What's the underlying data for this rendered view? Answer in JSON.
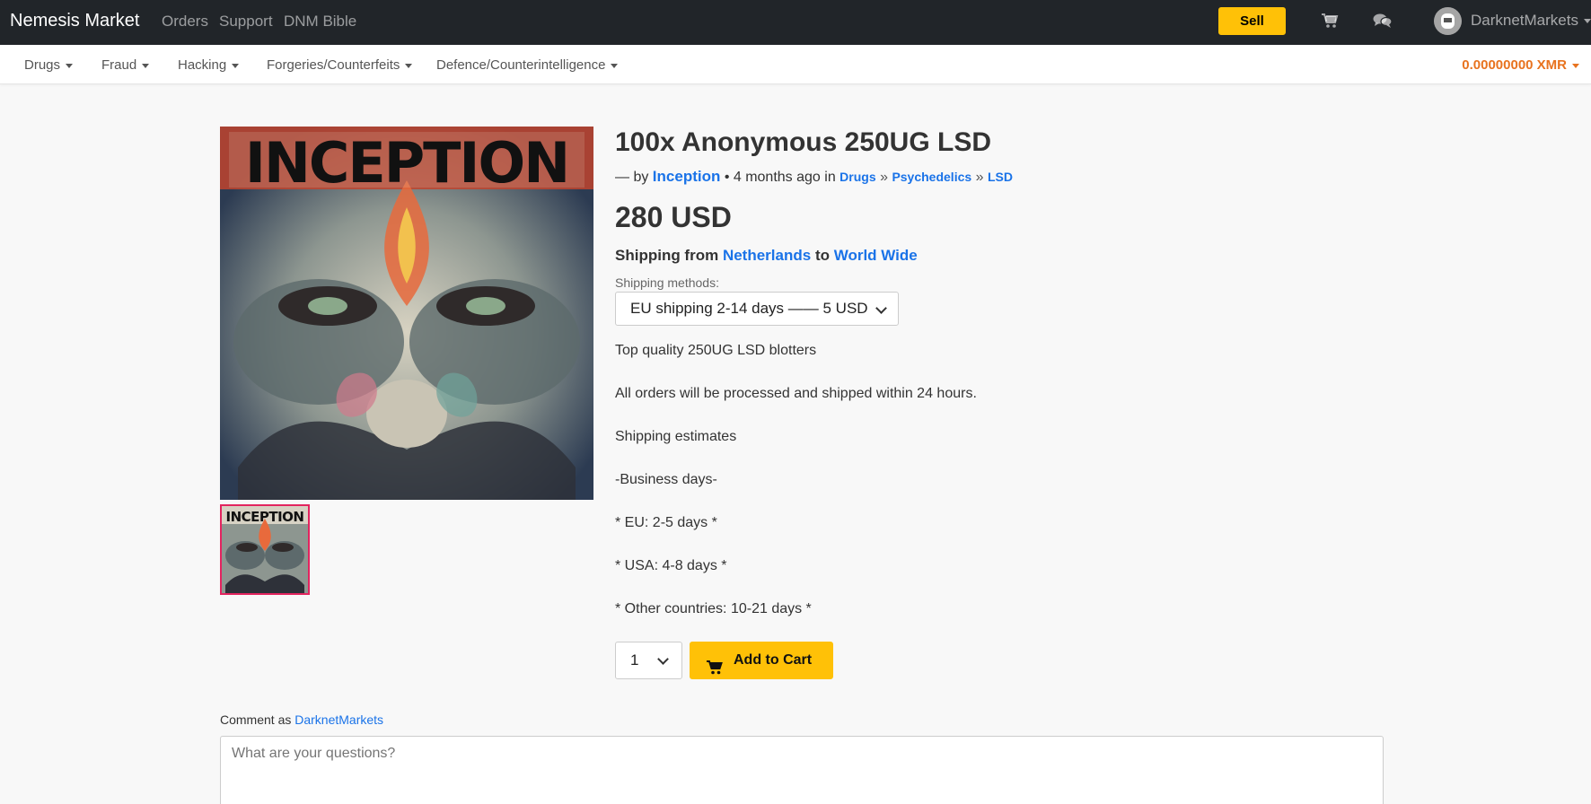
{
  "nav": {
    "brand": "Nemesis Market",
    "links": [
      "Orders",
      "Support",
      "DNM Bible"
    ],
    "sell_label": "Sell",
    "username": "DarknetMarkets"
  },
  "categories": [
    "Drugs",
    "Fraud",
    "Hacking",
    "Forgeries/Counterfeits",
    "Defence/Counterintelligence"
  ],
  "balance": "0.00000000 XMR",
  "product": {
    "image_text": "INCEPTION",
    "title": "100x Anonymous 250UG LSD",
    "by_prefix": "— by",
    "vendor": "Inception",
    "time": "• 4 months ago in",
    "breadcrumb": [
      "Drugs",
      "Psychedelics",
      "LSD"
    ],
    "breadcrumb_sep": "»",
    "price": "280 USD",
    "shipping_prefix": "Shipping from",
    "ship_from": "Netherlands",
    "shipping_to_word": "to",
    "ship_to": "World Wide",
    "shipping_methods_label": "Shipping methods:",
    "shipping_method_selected": "EU shipping 2-14 days —— 5 USD",
    "description": [
      "Top quality 250UG LSD blotters",
      "All orders will be processed and shipped within 24 hours.",
      "Shipping estimates",
      "-Business days-",
      "* EU: 2-5 days *",
      "* USA: 4-8 days *",
      "* Other countries: 10-21 days *"
    ],
    "quantity": "1",
    "add_to_cart_label": "Add to Cart"
  },
  "comment": {
    "label_prefix": "Comment as",
    "user": "DarknetMarkets",
    "placeholder": "What are your questions?"
  },
  "colors": {
    "navbar": "#212529",
    "accent": "#ffc107",
    "link": "#1a73e8",
    "balance": "#e8731f",
    "thumb_border": "#e3245f"
  }
}
